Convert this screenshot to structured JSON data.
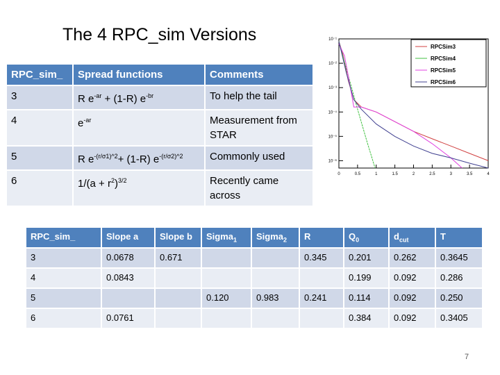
{
  "title": "The 4 RPC_sim Versions",
  "table1": {
    "headers": [
      "RPC_sim_",
      "Spread functions",
      "Comments"
    ],
    "rows": [
      {
        "id": "3",
        "func_html": "R e<sup>-ar</sup> + (1-R) e<sup>-br</sup>",
        "comment": "To help the tail"
      },
      {
        "id": "4",
        "func_html": "e<sup>-ar</sup>",
        "comment": "Measurement from STAR"
      },
      {
        "id": "5",
        "func_html": "R e<sup>-(r/σ1)^2</sup>+ (1-R) e<sup>-(r/σ2)^2</sup>",
        "comment": "Commonly used"
      },
      {
        "id": "6",
        "func_html": "1/(a + r<sup>2</sup>)<sup>3/2</sup>",
        "comment": "Recently came across"
      }
    ]
  },
  "table2": {
    "headers_html": [
      "RPC_sim_",
      "Slope a",
      "Slope b",
      "Sigma<sub>1</sub>",
      "Sigma<sub>2</sub>",
      "R",
      "Q<sub>0</sub>",
      "d<sub>cut</sub>",
      "T"
    ],
    "rows": [
      [
        "3",
        "0.0678",
        "0.671",
        "",
        "",
        "0.345",
        "0.201",
        "0.262",
        "0.3645"
      ],
      [
        "4",
        "0.0843",
        "",
        "",
        "",
        "",
        "0.199",
        "0.092",
        "0.286"
      ],
      [
        "5",
        "",
        "",
        "0.120",
        "0.983",
        "0.241",
        "0.114",
        "0.092",
        "0.250"
      ],
      [
        "6",
        "0.0761",
        "",
        "",
        "",
        "",
        "0.384",
        "0.092",
        "0.3405"
      ]
    ]
  },
  "chart_data": {
    "type": "line",
    "xlim": [
      0,
      4
    ],
    "ylim": [
      5e-07,
      0.1
    ],
    "yscale": "log",
    "xticks": [
      "0",
      "0.5",
      "1",
      "1.5",
      "2",
      "2.5",
      "3",
      "3.5",
      "4"
    ],
    "yticks": [
      "10⁻¹",
      "10⁻²",
      "10⁻³",
      "10⁻⁴",
      "10⁻⁵",
      "10⁻⁶"
    ],
    "legend_placement": "top-right",
    "series": [
      {
        "name": "RPCSim3",
        "color": "#d04040",
        "x": [
          0,
          0.1,
          0.25,
          0.4,
          0.6,
          1,
          1.5,
          2,
          2.5,
          3,
          3.5,
          4
        ],
        "y": [
          0.079,
          0.025,
          0.002,
          0.00032,
          0.00016,
          0.0001,
          4e-05,
          1.6e-05,
          7.9e-06,
          4e-06,
          2e-06,
          1e-06
        ]
      },
      {
        "name": "RPCSim4",
        "color": "#40c040",
        "x": [
          0,
          0.25,
          0.5,
          0.75,
          0.97
        ],
        "y": [
          0.079,
          0.0032,
          0.00013,
          6.3e-06,
          5e-07
        ]
      },
      {
        "name": "RPCSim5",
        "color": "#e040e0",
        "x": [
          0,
          0.15,
          0.25,
          0.4,
          0.6,
          1,
          1.5,
          2,
          2.5,
          3,
          3.3
        ],
        "y": [
          0.063,
          0.02,
          0.0032,
          0.00016,
          0.00016,
          0.0001,
          4e-05,
          1.6e-05,
          5e-06,
          1.3e-06,
          5e-07
        ]
      },
      {
        "name": "RPCSim6",
        "color": "#404090",
        "x": [
          0,
          0.2,
          0.4,
          0.6,
          1,
          1.5,
          2,
          2.5,
          3,
          3.5,
          4
        ],
        "y": [
          0.079,
          0.004,
          0.00032,
          0.00013,
          3.2e-05,
          1e-05,
          4e-06,
          2e-06,
          1.3e-06,
          7.9e-07,
          5e-07
        ]
      }
    ]
  },
  "page_number": "7"
}
